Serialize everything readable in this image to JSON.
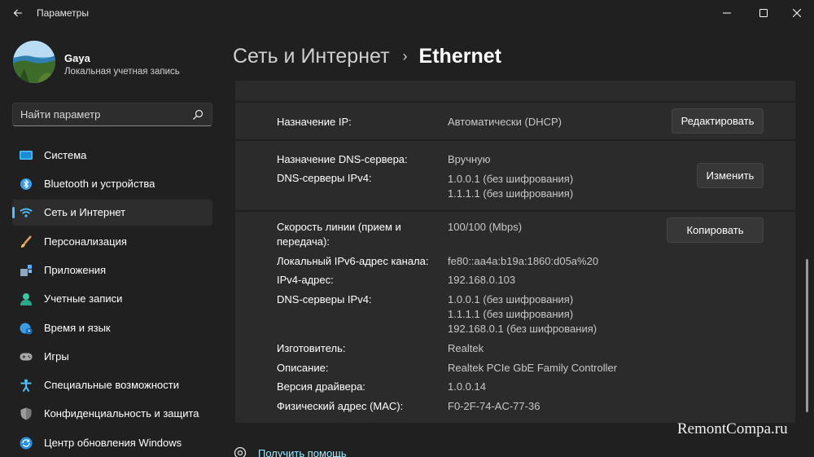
{
  "window": {
    "title": "Параметры"
  },
  "profile": {
    "name": "Gaya",
    "account_type": "Локальная учетная запись"
  },
  "search": {
    "placeholder": "Найти параметр"
  },
  "sidebar": {
    "items": [
      {
        "label": "Система",
        "icon": "system-icon"
      },
      {
        "label": "Bluetooth и устройства",
        "icon": "bluetooth-icon"
      },
      {
        "label": "Сеть и Интернет",
        "icon": "wifi-icon",
        "selected": true
      },
      {
        "label": "Персонализация",
        "icon": "brush-icon"
      },
      {
        "label": "Приложения",
        "icon": "apps-icon"
      },
      {
        "label": "Учетные записи",
        "icon": "person-icon"
      },
      {
        "label": "Время и язык",
        "icon": "globe-clock-icon"
      },
      {
        "label": "Игры",
        "icon": "gamepad-icon"
      },
      {
        "label": "Специальные возможности",
        "icon": "accessibility-icon"
      },
      {
        "label": "Конфиденциальность и защита",
        "icon": "shield-icon"
      },
      {
        "label": "Центр обновления Windows",
        "icon": "update-icon"
      }
    ]
  },
  "breadcrumb": {
    "parent": "Сеть и Интернет",
    "separator": "›",
    "current": "Ethernet"
  },
  "ip_assignment": {
    "label": "Назначение IP:",
    "value": "Автоматически (DHCP)",
    "button": "Редактировать"
  },
  "dns_assignment": {
    "label": "Назначение DNS-сервера:",
    "value": "Вручную",
    "servers_label": "DNS-серверы IPv4:",
    "servers": [
      "1.0.0.1 (без шифрования)",
      "1.1.1.1 (без шифрования)"
    ],
    "button": "Изменить"
  },
  "properties": {
    "copy_button": "Копировать",
    "rows": [
      {
        "label": "Скорость линии (прием и",
        "label2": "передача):",
        "value": "100/100 (Mbps)"
      },
      {
        "label": "Локальный IPv6-адрес канала:",
        "value": "fe80::aa4a:b19a:1860:d05a%20"
      },
      {
        "label": "IPv4-адрес:",
        "value": "192.168.0.103"
      },
      {
        "label": "DNS-серверы IPv4:",
        "values": [
          "1.0.0.1 (без шифрования)",
          "1.1.1.1 (без шифрования)",
          "192.168.0.1 (без шифрования)"
        ]
      },
      {
        "label": "Изготовитель:",
        "value": "Realtek"
      },
      {
        "label": "Описание:",
        "value": "Realtek PCIe GbE Family Controller"
      },
      {
        "label": "Версия драйвера:",
        "value": "1.0.0.14"
      },
      {
        "label": "Физический адрес (MAC):",
        "value": "F0-2F-74-AC-77-36"
      }
    ]
  },
  "help": {
    "link": "Получить помощь"
  },
  "watermark": "RemontCompa.ru",
  "colors": {
    "accent": "#4cc2ff",
    "background": "#202020",
    "card": "#2b2b2b",
    "link": "#99ebff"
  }
}
